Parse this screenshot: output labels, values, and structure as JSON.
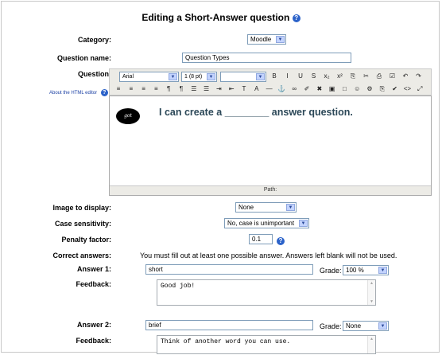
{
  "title": "Editing a Short-Answer question",
  "category": {
    "label": "Category:",
    "value": "Moodle"
  },
  "question_name": {
    "label": "Question name:",
    "value": "Question Types"
  },
  "question": {
    "label": "Question:",
    "html_editor_link": "About the HTML editor",
    "font_family": "Arial",
    "font_size": "1 (8 pt)",
    "toolbar_row1": [
      "B",
      "I",
      "U",
      "S",
      "x₂",
      "x²",
      "⎘",
      "✂",
      "⎙",
      "☑",
      "↶",
      "↷"
    ],
    "toolbar_row2": [
      "≡",
      "≡",
      "≡",
      "≡",
      "¶",
      "¶",
      "☰",
      "☰",
      "⇥",
      "⇤",
      "T",
      "A",
      "—",
      "⚓",
      "∞",
      "✐",
      "✖",
      "▣",
      "□",
      "☺",
      "⚙",
      "⎘",
      "✔",
      "<>",
      "⤢"
    ],
    "logo_text": "got moodle?",
    "content": "I can create a ________ answer question.",
    "path_label": "Path:"
  },
  "image_to_display": {
    "label": "Image to display:",
    "value": "None"
  },
  "case_sensitivity": {
    "label": "Case sensitivity:",
    "value": "No, case is unimportant"
  },
  "penalty_factor": {
    "label": "Penalty factor:",
    "value": "0.1"
  },
  "correct_answers": {
    "label": "Correct answers:",
    "note": "You must fill out at least one possible answer. Answers left blank will not be used."
  },
  "answers": [
    {
      "label": "Answer 1:",
      "value": "short",
      "grade_label": "Grade:",
      "grade": "100 %",
      "feedback_label": "Feedback:",
      "feedback": "Good job!"
    },
    {
      "label": "Answer 2:",
      "value": "brief",
      "grade_label": "Grade:",
      "grade": "None",
      "feedback_label": "Feedback:",
      "feedback": "Think of another word you can use."
    }
  ],
  "colors": {
    "help_icon": "#2b62c9",
    "editor_text": "#2c4858",
    "toolbar_bg": "#ecebe6",
    "field_border": "#7f9db9"
  }
}
